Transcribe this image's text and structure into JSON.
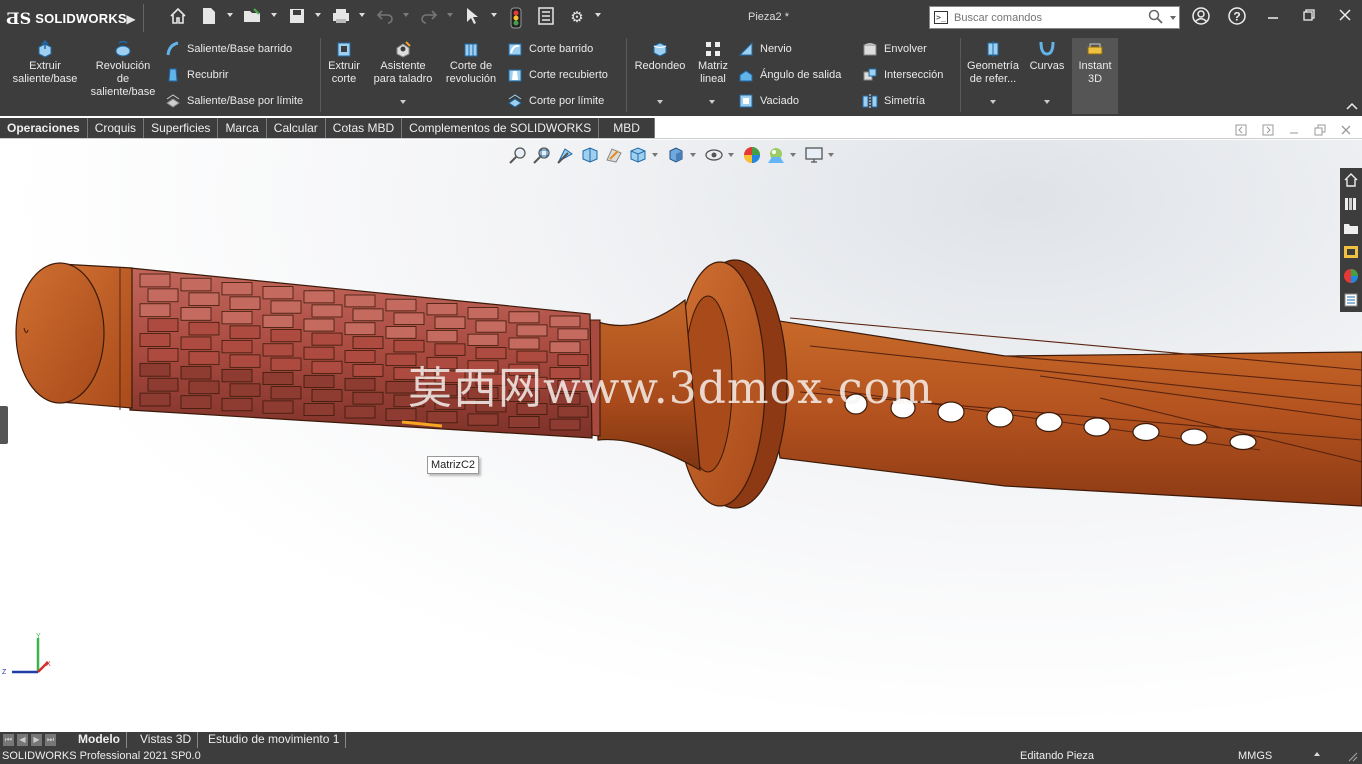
{
  "titlebar": {
    "brand": "SOLIDWORKS",
    "document_title": "Pieza2 *",
    "search_placeholder": "Buscar comandos",
    "icons": [
      "home-icon",
      "new-document-icon",
      "open-icon",
      "save-icon",
      "print-icon",
      "undo-icon",
      "redo-icon",
      "select-arrow-icon",
      "rebuild-icon",
      "file-properties-icon",
      "options-gear-icon",
      "user-account-icon",
      "help-icon",
      "minimize-icon",
      "restore-icon",
      "close-icon"
    ]
  },
  "ribbon": {
    "extruir_saliente": "Extruir\nsaliente/base",
    "revolucion_saliente": "Revolución\nde\nsaliente/base",
    "saliente_barrido": "Saliente/Base barrido",
    "recubrir": "Recubrir",
    "saliente_limite": "Saliente/Base por límite",
    "extruir_corte": "Extruir\ncorte",
    "asistente_taladro": "Asistente\npara taladro",
    "corte_revolucion": "Corte de\nrevolución",
    "corte_barrido": "Corte barrido",
    "corte_recubierto": "Corte recubierto",
    "corte_limite": "Corte por límite",
    "redondeo": "Redondeo",
    "matriz_lineal": "Matriz\nlineal",
    "nervio": "Nervio",
    "angulo_salida": "Ángulo de salida",
    "vaciado": "Vaciado",
    "envolver": "Envolver",
    "interseccion": "Intersección",
    "simetria": "Simetría",
    "geometria_ref": "Geometría\nde refer...",
    "curvas": "Curvas",
    "instant3d": "Instant\n3D"
  },
  "tabs": [
    "Operaciones",
    "Croquis",
    "Superficies",
    "Marca",
    "Calcular",
    "Cotas MBD",
    "Complementos de SOLIDWORKS",
    "MBD"
  ],
  "viewport": {
    "watermark": "莫西网www.3dmox.com",
    "tooltip": "MatrizC2",
    "triad_axes": [
      "Y",
      "Z",
      "X"
    ]
  },
  "bottom_tabs": [
    "Modelo",
    "Vistas 3D",
    "Estudio de movimiento 1"
  ],
  "status": {
    "product": "SOLIDWORKS Professional 2021 SP0.0",
    "mode": "Editando Pieza",
    "units": "MMGS"
  },
  "colors": {
    "chrome": "#3d3d3d",
    "model_main": "#b4531f",
    "model_dark": "#7a2e12",
    "grip": "#a94a3f"
  }
}
